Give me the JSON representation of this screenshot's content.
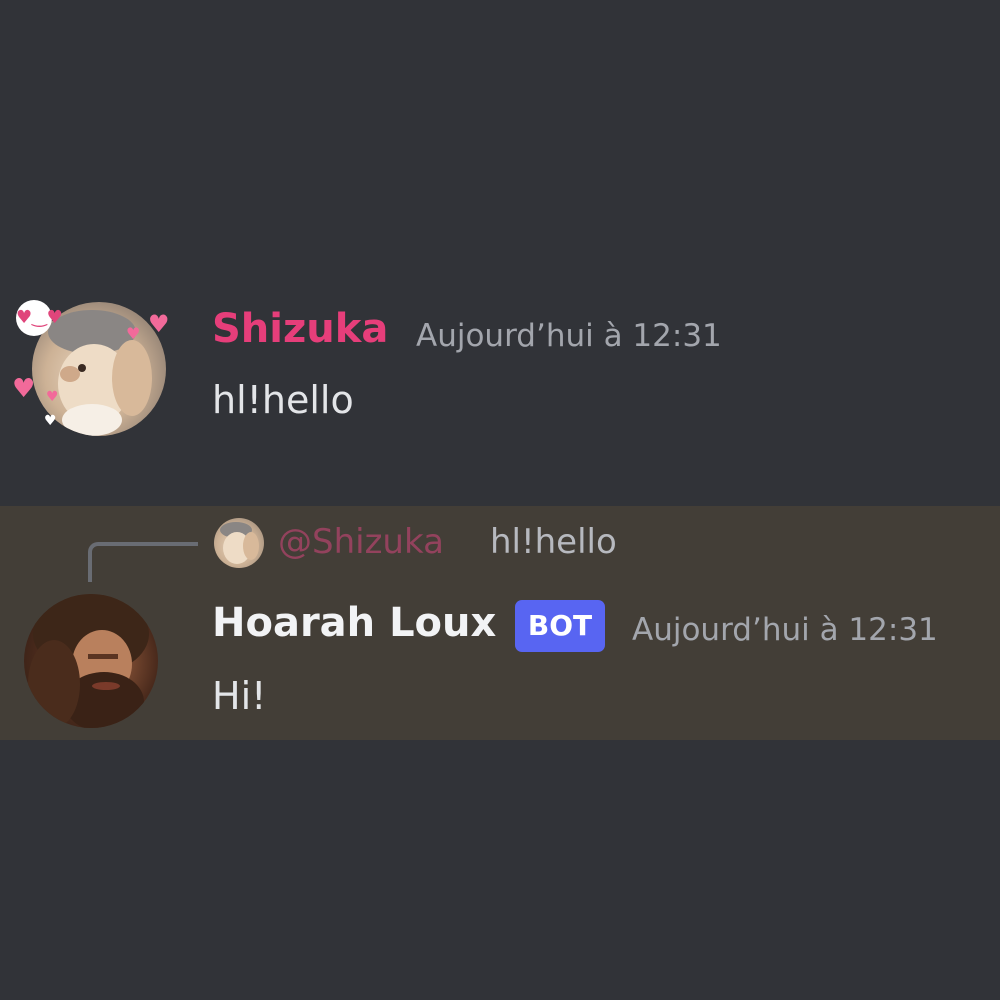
{
  "messages": [
    {
      "author": "Shizuka",
      "timestamp": "Aujourd’hui à 12:31",
      "content": "hl!hello",
      "author_color": "#e63e7a",
      "avatar_icon": "rabbit-avatar"
    },
    {
      "author": "Hoarah Loux",
      "badge": "BOT",
      "timestamp": "Aujourd’hui à 12:31",
      "content": "Hi!",
      "avatar_icon": "bearded-man-avatar",
      "reply": {
        "mention": "@Shizuka",
        "text": "hl!hello"
      }
    }
  ],
  "colors": {
    "background": "#313338",
    "highlight": "#433e37",
    "bot_badge": "#5865f2",
    "timestamp": "#a3a6ad",
    "text": "#e3e5e8"
  }
}
